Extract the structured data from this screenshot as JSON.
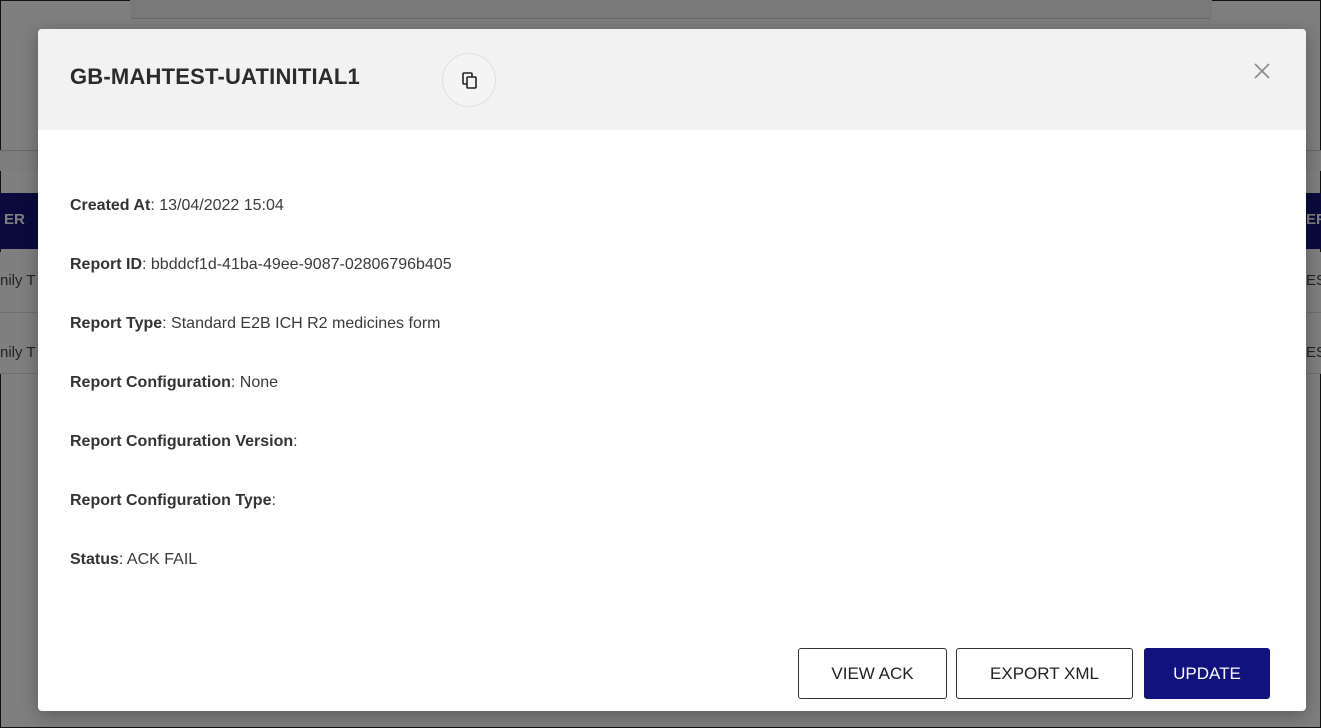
{
  "background": {
    "header_fragment_left": "ER",
    "header_fragment_right": "EF",
    "row_fragment_left": "nily T",
    "row_fragment_right": "ES",
    "header_color": "#14147a"
  },
  "modal": {
    "title": "GB-MAHTEST-UATINITIAL1",
    "copy_icon": "copy-icon",
    "close_icon": "close-icon",
    "details": [
      {
        "label": "Created At",
        "value": "13/04/2022 15:04"
      },
      {
        "label": "Report ID",
        "value": "bbddcf1d-41ba-49ee-9087-02806796b405"
      },
      {
        "label": "Report Type",
        "value": "Standard E2B ICH R2 medicines form"
      },
      {
        "label": "Report Configuration",
        "value": "None"
      },
      {
        "label": "Report Configuration Version",
        "value": ""
      },
      {
        "label": "Report Configuration Type",
        "value": ""
      },
      {
        "label": "Status",
        "value": "ACK FAIL"
      }
    ],
    "buttons": {
      "view_ack": "VIEW ACK",
      "export_xml": "EXPORT XML",
      "update": "UPDATE"
    },
    "primary_color": "#12127f"
  }
}
